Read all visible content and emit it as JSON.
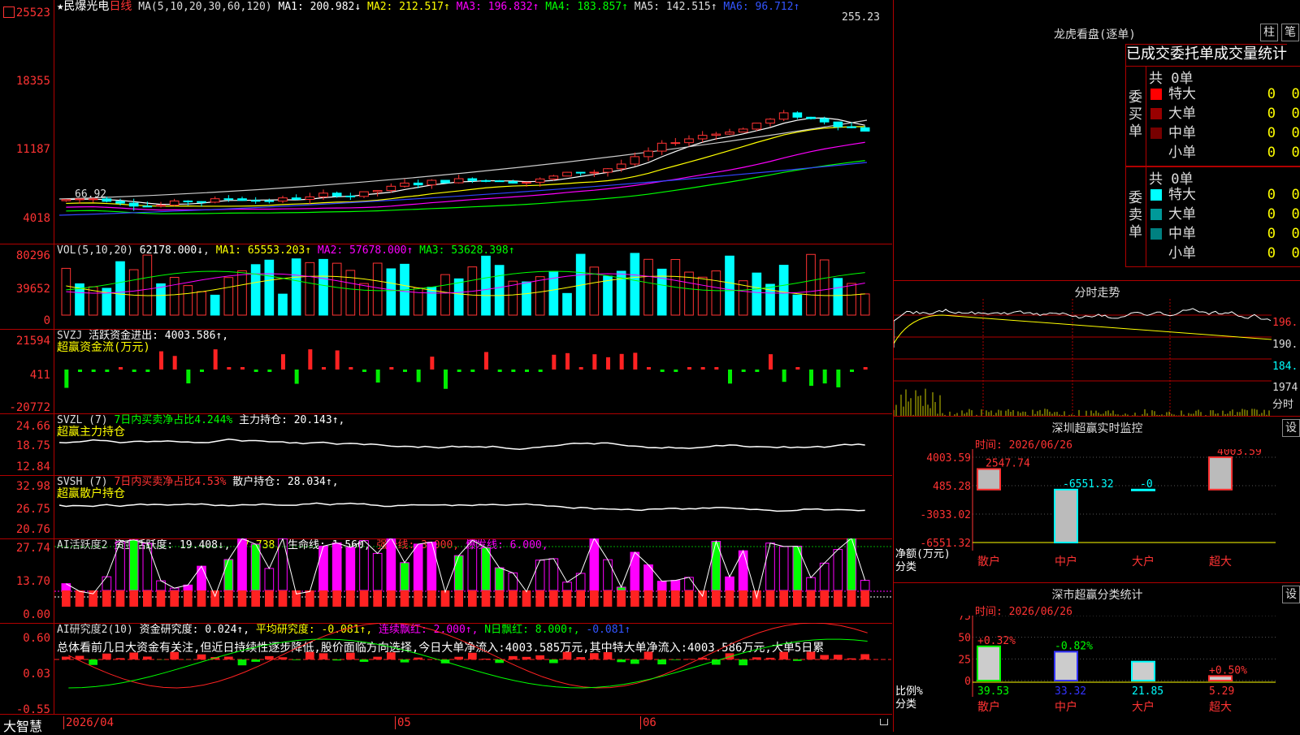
{
  "stock": {
    "name": "★民爆光电",
    "period": "日线",
    "ma_label": "MA(5,10,20,30,60,120)",
    "ma": [
      {
        "label": "MA1: 200.982↓",
        "color": "#ffffff"
      },
      {
        "label": "MA2: 212.517↑",
        "color": "#ffff00"
      },
      {
        "label": "MA3: 196.832↑",
        "color": "#ff00ff"
      },
      {
        "label": "MA4: 183.857↑",
        "color": "#00ff00"
      },
      {
        "label": "MA5: 142.515↑",
        "color": "#cccccc"
      },
      {
        "label": "MA6: 96.712↑",
        "color": "#3355ff"
      }
    ],
    "y_ticks": [
      "25523",
      "18355",
      "11187",
      "4018"
    ],
    "high_label": "255.23",
    "low_label": "66.92"
  },
  "vol": {
    "label": "VOL(5,10,20)",
    "value": "62178.000↓",
    "ma": [
      {
        "label": "MA1: 65553.203↑",
        "color": "#ffff00"
      },
      {
        "label": "MA2: 57678.000↑",
        "color": "#ff00ff"
      },
      {
        "label": "MA3: 53628.398↑",
        "color": "#00ff00"
      }
    ],
    "y_ticks": [
      "80296",
      "39652",
      "0"
    ]
  },
  "svzj": {
    "label": "SVZJ",
    "text": "活跃资金进出: 4003.586↑,",
    "sub": "超赢资金流(万元)",
    "y_ticks": [
      "21594",
      "411",
      "-20772"
    ]
  },
  "svzl": {
    "label": "SVZL (7)",
    "text1": "7日内买卖净占比4.244%",
    "text2": "主力持仓: 20.143↑,",
    "sub": "超赢主力持仓",
    "y_ticks": [
      "24.66",
      "18.75",
      "12.84"
    ]
  },
  "svsh": {
    "label": "SVSH (7)",
    "text1": "7日内买卖净占比4.53%",
    "text2": "散户持仓: 28.034↑,",
    "sub": "超赢散户持仓",
    "y_ticks": [
      "32.98",
      "26.75",
      "20.76"
    ]
  },
  "ai_active": {
    "label": "AI活跃度2",
    "text1": "资金活跃度: 19.408↓,",
    "text2": "27.738,",
    "text3": "生命线: 1.560,",
    "text4": "强势线: 3.000,",
    "text5": "爆发线: 6.000,",
    "y_ticks": [
      "27.74",
      "13.70",
      "0.00"
    ]
  },
  "ai_research": {
    "label": "AI研究度2(10)",
    "text1": "资金研究度: 0.024↑,",
    "text2": "平均研究度: -0.081↑,",
    "text3": "连续飘红: 2.000↑,",
    "text4": "N日飘红: 8.000↑,",
    "text5": "-0.081↑",
    "comment": "总体看前几日大资金有关注,但近日持续性逐步降低,股价面临方向选择,今日大单净流入:4003.585万元,其中特大单净流入:4003.586万元,大单5日累",
    "y_ticks": [
      "0.60",
      "0.03",
      "-0.55"
    ]
  },
  "bottom": {
    "brand": "大智慧",
    "dates": [
      "2026/04",
      "05",
      "06"
    ]
  },
  "lhb": {
    "title": "龙虎看盘(逐单)",
    "btn_bar": "柱",
    "btn_pen": "笔",
    "tabs": [
      "已成交",
      "委托单",
      "成交量",
      "统计"
    ],
    "buy_label": "委买单",
    "sell_label": "委卖单",
    "buy_total": "共 0单",
    "sell_total": "共 0单",
    "buy_rows": [
      {
        "name": "特大",
        "v": "0",
        "p": "0%",
        "color": "#ff0000"
      },
      {
        "name": "大单",
        "v": "0",
        "p": "0%",
        "color": "#990000"
      },
      {
        "name": "中单",
        "v": "0",
        "p": "0%",
        "color": "#770000"
      },
      {
        "name": "小单",
        "v": "0",
        "p": "0%",
        "color": "#000000"
      }
    ],
    "sell_rows": [
      {
        "name": "特大",
        "v": "0",
        "p": "0%",
        "color": "#00ffff"
      },
      {
        "name": "大单",
        "v": "0",
        "p": "0%",
        "color": "#009999"
      },
      {
        "name": "中单",
        "v": "0",
        "p": "0%",
        "color": "#008080"
      },
      {
        "name": "小单",
        "v": "0",
        "p": "0%",
        "color": "#000000"
      }
    ]
  },
  "intraday": {
    "title": "分时走势",
    "y_ticks": [
      "196.",
      "190.",
      "184.",
      "1974"
    ],
    "vol_label": "分时"
  },
  "sz_monitor": {
    "title": "深圳超赢实时监控",
    "btn": "设",
    "time": "时间: 2026/06/26",
    "y_ticks": [
      "4003.59",
      "485.28",
      "-3033.02",
      "-6551.32"
    ],
    "unit": "净额(万元)",
    "cat_label": "分类",
    "bars": [
      {
        "cat": "散户",
        "val": "2547.74",
        "value": 2547.74
      },
      {
        "cat": "中户",
        "val": "-6551.32",
        "value": -6551.32
      },
      {
        "cat": "大户",
        "val": "-0",
        "value": 0
      },
      {
        "cat": "超大",
        "val": "4003.59",
        "value": 4003.59
      }
    ]
  },
  "sz_class": {
    "title": "深市超赢分类统计",
    "btn": "设",
    "time": "时间: 2026/06/26",
    "y_ticks": [
      "75",
      "50",
      "25",
      "0"
    ],
    "unit": "比例%",
    "cat_label": "分类",
    "bars": [
      {
        "cat": "散户",
        "pct": "39.53",
        "chg": "+0.32%",
        "value": 39.53
      },
      {
        "cat": "中户",
        "pct": "33.32",
        "chg": "-0.82%",
        "value": 33.32
      },
      {
        "cat": "大户",
        "pct": "21.85",
        "chg": "",
        "value": 21.85
      },
      {
        "cat": "超大",
        "pct": "5.29",
        "chg": "+0.50%",
        "value": 5.29
      }
    ]
  }
}
